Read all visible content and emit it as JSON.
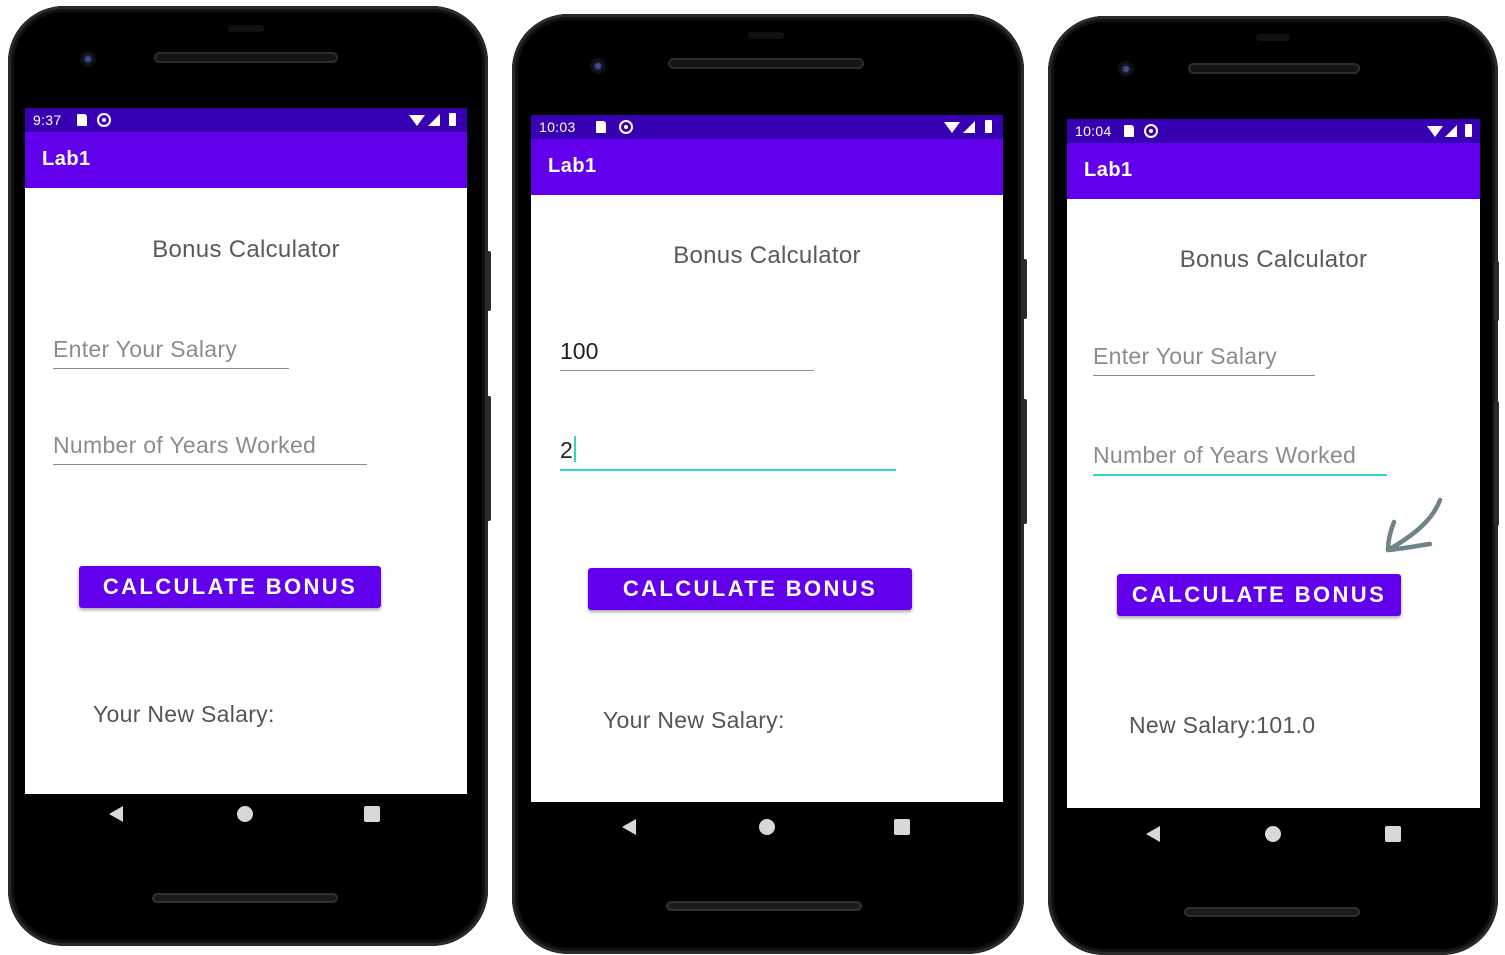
{
  "screens": [
    {
      "status_time": "9:37",
      "app_title": "Lab1",
      "heading": "Bonus Calculator",
      "salary": {
        "value": "",
        "placeholder": "Enter Your Salary"
      },
      "years": {
        "value": "",
        "placeholder": "Number of Years Worked"
      },
      "button_label": "CALCULATE BONUS",
      "result_text": "Your New Salary:"
    },
    {
      "status_time": "10:03",
      "app_title": "Lab1",
      "heading": "Bonus Calculator",
      "salary": {
        "value": "100",
        "placeholder": ""
      },
      "years": {
        "value": "2",
        "placeholder": ""
      },
      "button_label": "CALCULATE BONUS",
      "result_text": "Your New Salary:"
    },
    {
      "status_time": "10:04",
      "app_title": "Lab1",
      "heading": "Bonus Calculator",
      "salary": {
        "value": "",
        "placeholder": "Enter Your Salary"
      },
      "years": {
        "value": "",
        "placeholder": "Number of Years Worked"
      },
      "button_label": "CALCULATE BONUS",
      "result_text": "New Salary:101.0"
    }
  ],
  "icons": {
    "status": [
      "sd-card-icon",
      "sync-icon",
      "wifi-icon",
      "cell-signal-icon",
      "battery-icon"
    ],
    "navigation": [
      "back-icon",
      "home-icon",
      "recents-icon"
    ],
    "annotation": "hand-drawn-arrow-icon"
  },
  "colors": {
    "status_bar": "#3700b3",
    "app_bar": "#6200ee",
    "button": "#6200ee",
    "focus_underline": "#36d3c1",
    "annotation_arrow": "#6f8486"
  }
}
